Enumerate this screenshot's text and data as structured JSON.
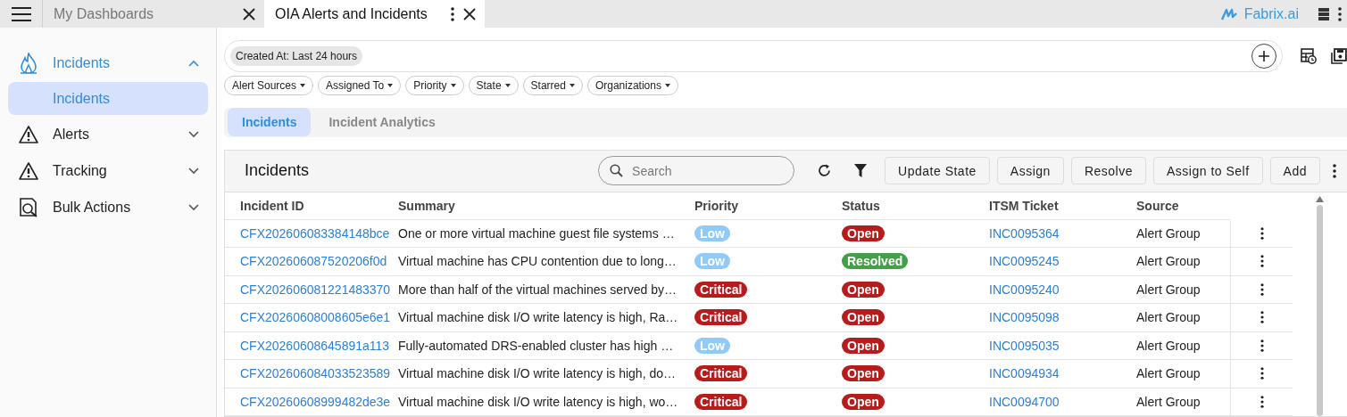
{
  "top_tabs": [
    {
      "label": "My Dashboards",
      "selected": false
    },
    {
      "label": "OIA Alerts and Incidents",
      "selected": true
    }
  ],
  "brand": "Fabrix.ai",
  "sidebar": {
    "items": [
      {
        "label": "Incidents",
        "kind": "flame",
        "expanded": true,
        "children": [
          {
            "label": "Incidents",
            "selected": true
          }
        ]
      },
      {
        "label": "Alerts",
        "kind": "warning",
        "expanded": false
      },
      {
        "label": "Tracking",
        "kind": "warning",
        "expanded": false
      },
      {
        "label": "Bulk Actions",
        "kind": "doc-search",
        "expanded": false
      }
    ]
  },
  "time_filter": "Created At: Last 24 hours",
  "filters": [
    "Alert Sources",
    "Assigned To",
    "Priority",
    "State",
    "Starred",
    "Organizations"
  ],
  "view_tabs": [
    {
      "label": "Incidents",
      "selected": true
    },
    {
      "label": "Incident Analytics",
      "selected": false
    }
  ],
  "table": {
    "title": "Incidents",
    "search": {
      "placeholder": "Search"
    },
    "actions": [
      "Update State",
      "Assign",
      "Resolve",
      "Assign to Self",
      "Add"
    ],
    "columns": [
      "Incident ID",
      "Summary",
      "Priority",
      "Status",
      "ITSM Ticket",
      "Source"
    ],
    "rows": [
      {
        "id": "CFX202606083384148bce",
        "summary": "One or more virtual machine guest file systems …",
        "priority": {
          "text": "Low",
          "color": "#90caf9"
        },
        "status": {
          "text": "Open",
          "color": "#b71c1c"
        },
        "ticket": "INC0095364",
        "source": "Alert Group"
      },
      {
        "id": "CFX202606087520206f0d",
        "summary": "Virtual machine has CPU contention due to long…",
        "priority": {
          "text": "Low",
          "color": "#90caf9"
        },
        "status": {
          "text": "Resolved",
          "color": "#43a047"
        },
        "ticket": "INC0095245",
        "source": "Alert Group"
      },
      {
        "id": "CFX202606081221483370",
        "summary": "More than half of the virtual machines served by…",
        "priority": {
          "text": "Critical",
          "color": "#b71c1c"
        },
        "status": {
          "text": "Open",
          "color": "#b71c1c"
        },
        "ticket": "INC0095240",
        "source": "Alert Group"
      },
      {
        "id": "CFX20260608008605e6e1",
        "summary": "Virtual machine disk I/O write latency is high, Ra…",
        "priority": {
          "text": "Critical",
          "color": "#b71c1c"
        },
        "status": {
          "text": "Open",
          "color": "#b71c1c"
        },
        "ticket": "INC0095098",
        "source": "Alert Group"
      },
      {
        "id": "CFX20260608645891a113",
        "summary": "Fully-automated DRS-enabled cluster has high …",
        "priority": {
          "text": "Low",
          "color": "#90caf9"
        },
        "status": {
          "text": "Open",
          "color": "#b71c1c"
        },
        "ticket": "INC0095035",
        "source": "Alert Group"
      },
      {
        "id": "CFX202606084033523589",
        "summary": "Virtual machine disk I/O write latency is high, do…",
        "priority": {
          "text": "Critical",
          "color": "#b71c1c"
        },
        "status": {
          "text": "Open",
          "color": "#b71c1c"
        },
        "ticket": "INC0094934",
        "source": "Alert Group"
      },
      {
        "id": "CFX20260608999482de3e",
        "summary": "Virtual machine disk I/O write latency is high, wo…",
        "priority": {
          "text": "Critical",
          "color": "#b71c1c"
        },
        "status": {
          "text": "Open",
          "color": "#b71c1c"
        },
        "ticket": "INC0094700",
        "source": "Alert Group"
      }
    ]
  }
}
